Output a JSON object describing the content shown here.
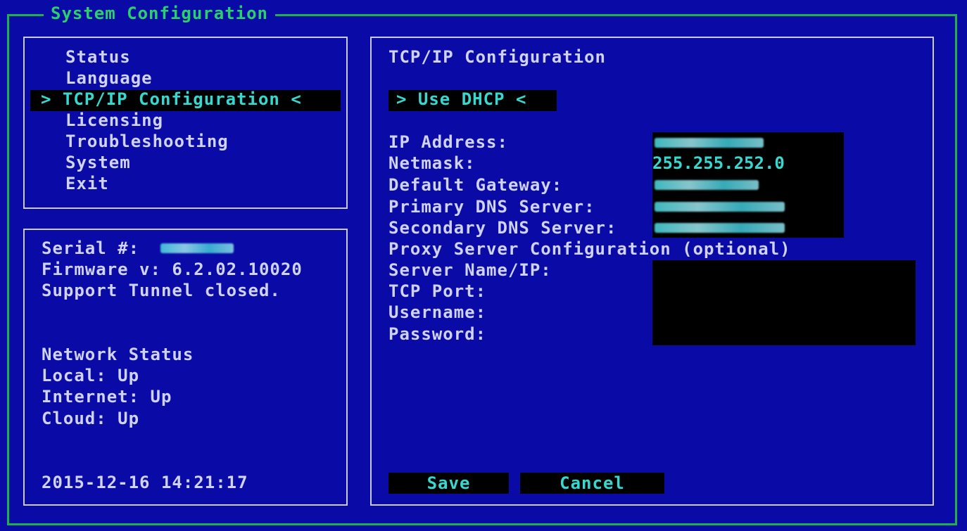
{
  "window": {
    "title": "System Configuration"
  },
  "menu": {
    "items": [
      "Status",
      "Language",
      "TCP/IP Configuration",
      "Licensing",
      "Troubleshooting",
      "System",
      "Exit"
    ],
    "selected_display": "> TCP/IP Configuration <"
  },
  "info": {
    "serial_label": "Serial #:",
    "firmware": "Firmware v: 6.2.02.10020",
    "tunnel": "Support Tunnel closed.",
    "network_status": "Network Status",
    "local": "Local: Up",
    "internet": "Internet: Up",
    "cloud": "Cloud: Up",
    "datetime": "2015-12-16 14:21:17"
  },
  "config": {
    "title": "TCP/IP Configuration",
    "dhcp_option": "> Use DHCP <",
    "ip_label": "IP Address:",
    "netmask_label": "Netmask:",
    "netmask_value": "255.255.252.0",
    "gateway_label": "Default Gateway:",
    "dns1_label": "Primary DNS Server:",
    "dns2_label": "Secondary DNS Server:",
    "proxy_header": "Proxy Server Configuration (optional)",
    "server_label": "Server Name/IP:",
    "port_label": "TCP Port:",
    "username_label": "Username:",
    "password_label": "Password:"
  },
  "buttons": {
    "save": "Save",
    "cancel": "Cancel"
  },
  "colors": {
    "background": "#0a0aa6",
    "frame": "#1fb04a",
    "highlight_text": "#38d8d0",
    "field_bg": "#000000"
  }
}
